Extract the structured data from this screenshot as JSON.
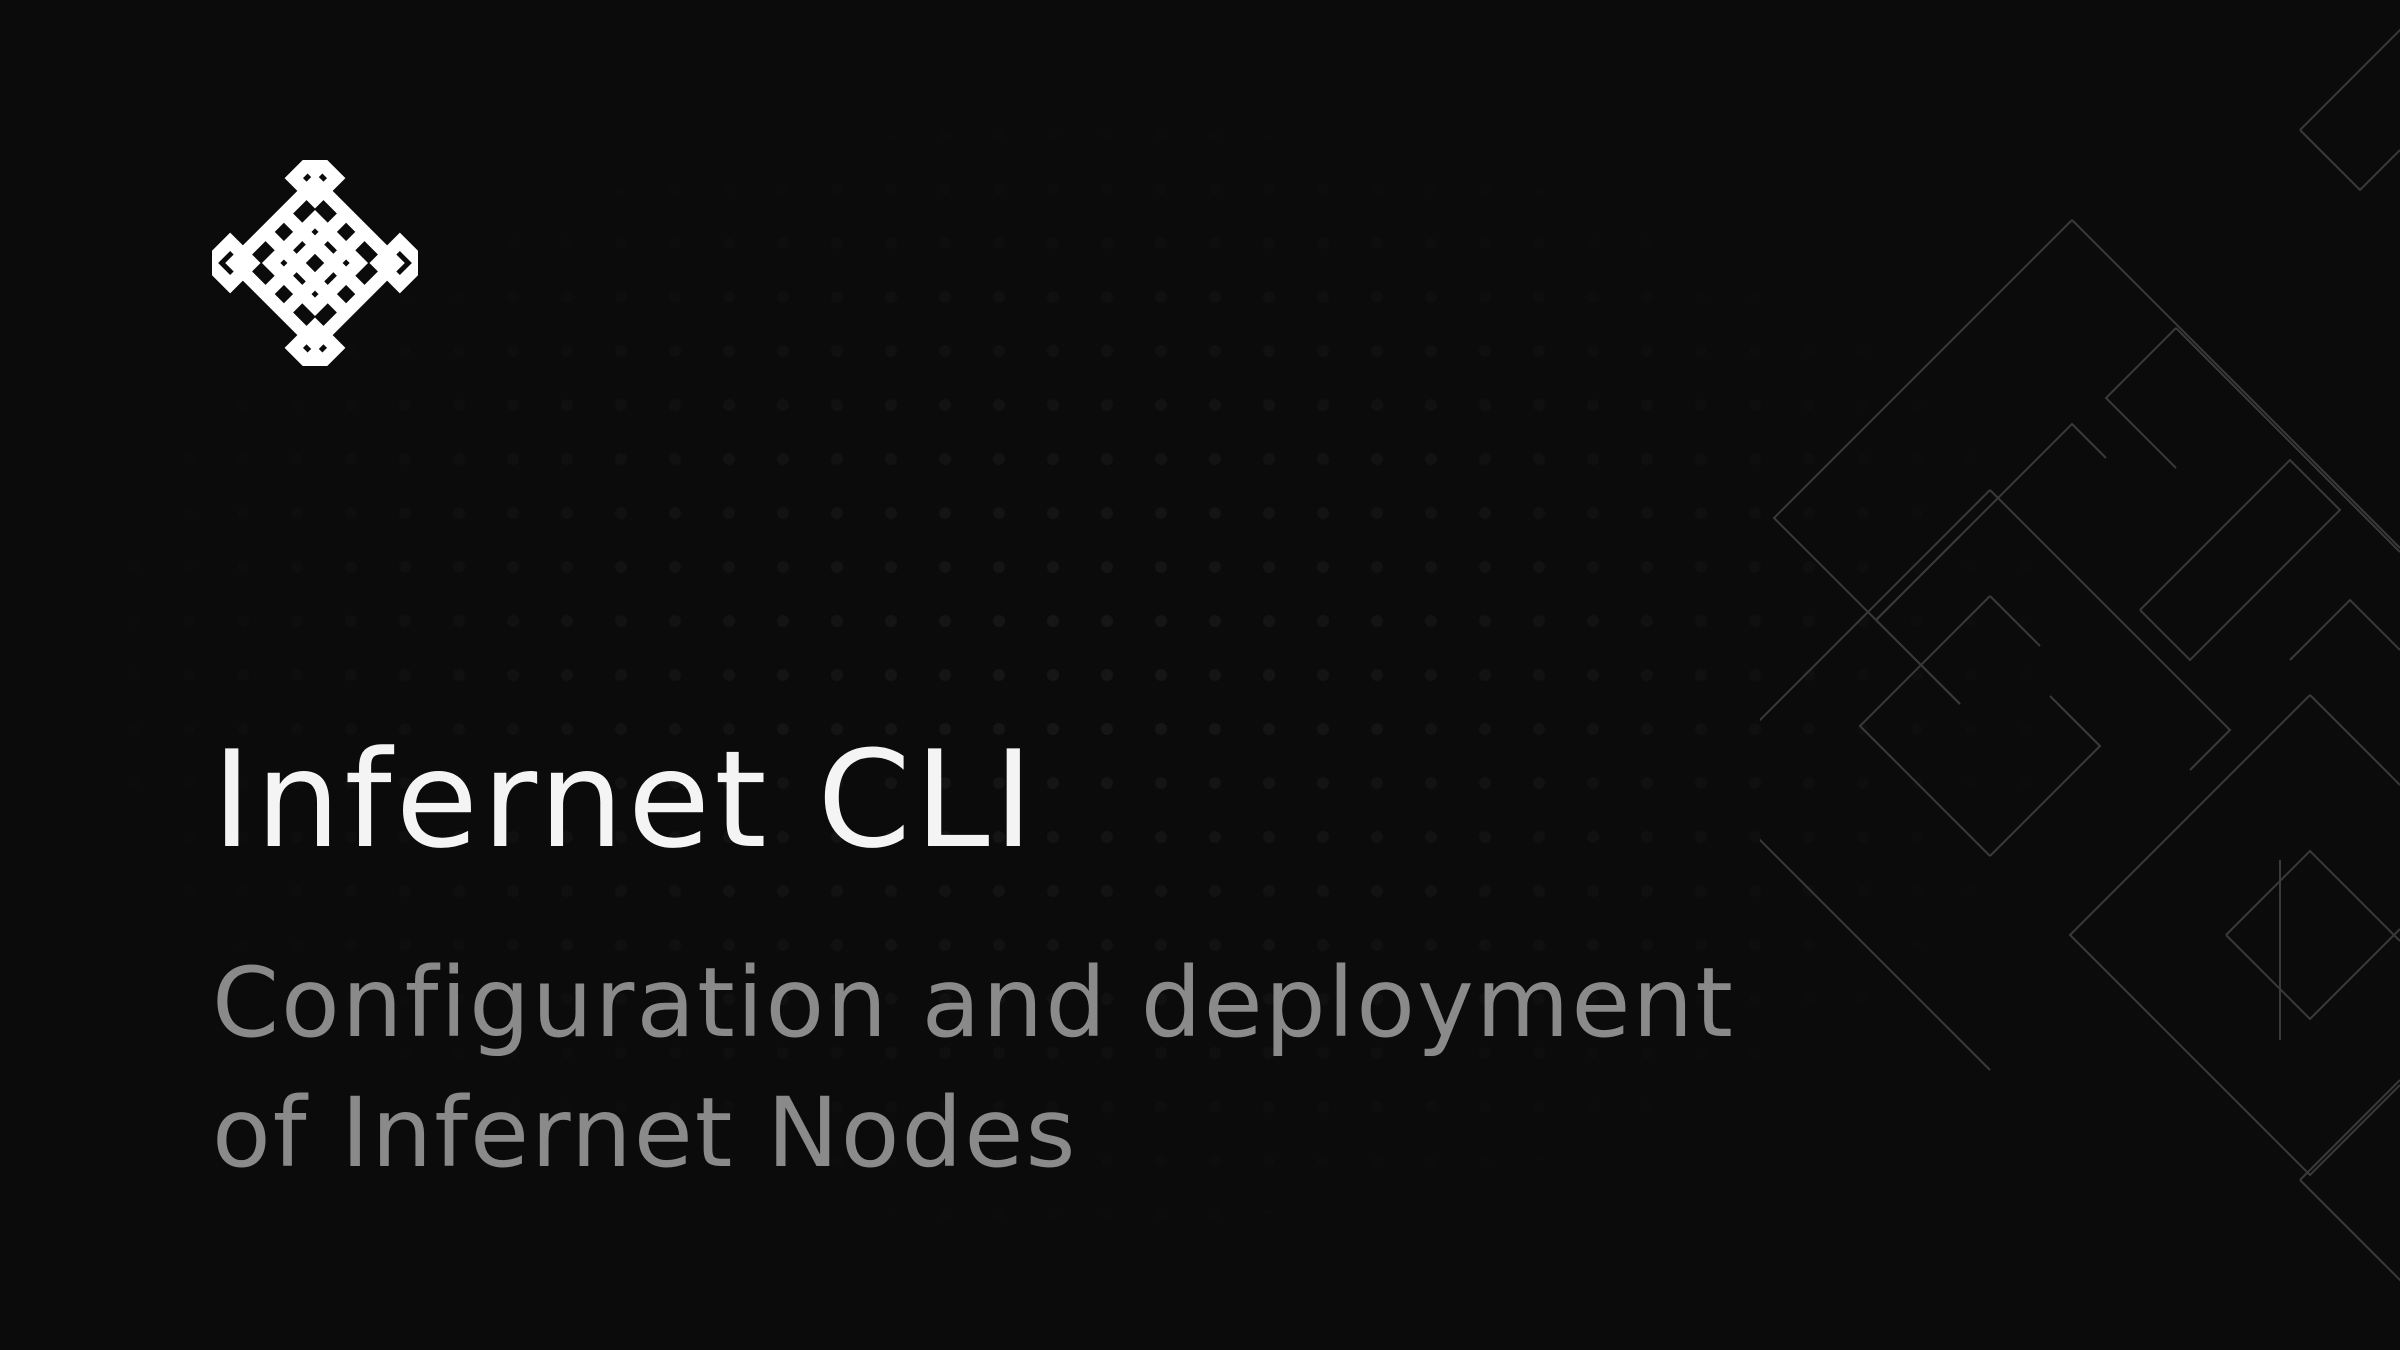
{
  "brand": {
    "logo_icon": "endless-knot-icon",
    "accent": "#ffffff"
  },
  "hero": {
    "title": "Infernet CLI",
    "subtitle_line1": "Configuration and deployment",
    "subtitle_line2": "of Infernet Nodes"
  },
  "colors": {
    "background": "#0b0b0b",
    "title": "#f4f4f4",
    "subtitle": "#8a8a8a",
    "decoration_stroke": "#3a3a3a"
  },
  "decoration": {
    "icon": "knot-outline-pattern"
  }
}
